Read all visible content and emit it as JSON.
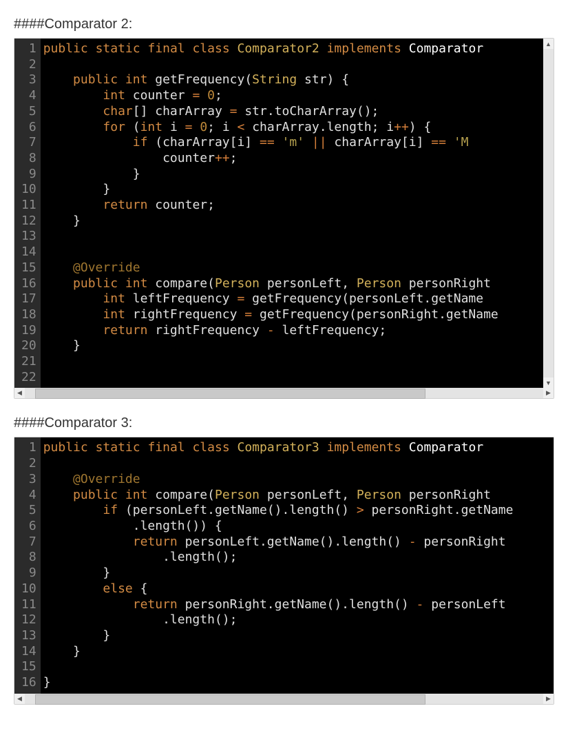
{
  "heading2": "####Comparator 2:",
  "heading3": "####Comparator 3:",
  "block2": {
    "line_count": 22,
    "lines": [
      [
        [
          "kw",
          "public"
        ],
        [
          "plain",
          " "
        ],
        [
          "kw",
          "static"
        ],
        [
          "plain",
          " "
        ],
        [
          "kw",
          "final"
        ],
        [
          "plain",
          " "
        ],
        [
          "kw",
          "class"
        ],
        [
          "plain",
          " "
        ],
        [
          "type",
          "Comparator2"
        ],
        [
          "plain",
          " "
        ],
        [
          "kw",
          "implements"
        ],
        [
          "plain",
          " "
        ],
        [
          "white",
          "Comparator"
        ]
      ],
      [
        [
          "plain",
          ""
        ]
      ],
      [
        [
          "plain",
          "    "
        ],
        [
          "kw",
          "public"
        ],
        [
          "plain",
          " "
        ],
        [
          "kw",
          "int"
        ],
        [
          "plain",
          " getFrequency("
        ],
        [
          "type",
          "String"
        ],
        [
          "plain",
          " str) {"
        ]
      ],
      [
        [
          "plain",
          "        "
        ],
        [
          "kw",
          "int"
        ],
        [
          "plain",
          " counter "
        ],
        [
          "op",
          "="
        ],
        [
          "plain",
          " "
        ],
        [
          "num",
          "0"
        ],
        [
          "plain",
          ";"
        ]
      ],
      [
        [
          "plain",
          "        "
        ],
        [
          "kw",
          "char"
        ],
        [
          "plain",
          "[] charArray "
        ],
        [
          "op",
          "="
        ],
        [
          "plain",
          " str.toCharArray();"
        ]
      ],
      [
        [
          "plain",
          "        "
        ],
        [
          "kw",
          "for"
        ],
        [
          "plain",
          " ("
        ],
        [
          "kw",
          "int"
        ],
        [
          "plain",
          " i "
        ],
        [
          "op",
          "="
        ],
        [
          "plain",
          " "
        ],
        [
          "num",
          "0"
        ],
        [
          "plain",
          "; i "
        ],
        [
          "op",
          "<"
        ],
        [
          "plain",
          " charArray.length; i"
        ],
        [
          "op",
          "++"
        ],
        [
          "plain",
          ") {"
        ]
      ],
      [
        [
          "plain",
          "            "
        ],
        [
          "kw",
          "if"
        ],
        [
          "plain",
          " (charArray[i] "
        ],
        [
          "op",
          "=="
        ],
        [
          "plain",
          " "
        ],
        [
          "str",
          "'m'"
        ],
        [
          "plain",
          " "
        ],
        [
          "op",
          "||"
        ],
        [
          "plain",
          " charArray[i] "
        ],
        [
          "op",
          "=="
        ],
        [
          "plain",
          " "
        ],
        [
          "str",
          "'M"
        ]
      ],
      [
        [
          "plain",
          "                counter"
        ],
        [
          "op",
          "++"
        ],
        [
          "plain",
          ";"
        ]
      ],
      [
        [
          "plain",
          "            }"
        ]
      ],
      [
        [
          "plain",
          "        }"
        ]
      ],
      [
        [
          "plain",
          "        "
        ],
        [
          "kw",
          "return"
        ],
        [
          "plain",
          " counter;"
        ]
      ],
      [
        [
          "plain",
          "    }"
        ]
      ],
      [
        [
          "plain",
          ""
        ]
      ],
      [
        [
          "plain",
          ""
        ]
      ],
      [
        [
          "plain",
          "    "
        ],
        [
          "ann",
          "@Override"
        ]
      ],
      [
        [
          "plain",
          "    "
        ],
        [
          "kw",
          "public"
        ],
        [
          "plain",
          " "
        ],
        [
          "kw",
          "int"
        ],
        [
          "plain",
          " compare("
        ],
        [
          "type",
          "Person"
        ],
        [
          "plain",
          " personLeft, "
        ],
        [
          "type",
          "Person"
        ],
        [
          "plain",
          " personRight"
        ]
      ],
      [
        [
          "plain",
          "        "
        ],
        [
          "kw",
          "int"
        ],
        [
          "plain",
          " leftFrequency "
        ],
        [
          "op",
          "="
        ],
        [
          "plain",
          " getFrequency(personLeft.getName"
        ]
      ],
      [
        [
          "plain",
          "        "
        ],
        [
          "kw",
          "int"
        ],
        [
          "plain",
          " rightFrequency "
        ],
        [
          "op",
          "="
        ],
        [
          "plain",
          " getFrequency(personRight.getName"
        ]
      ],
      [
        [
          "plain",
          "        "
        ],
        [
          "kw",
          "return"
        ],
        [
          "plain",
          " rightFrequency "
        ],
        [
          "op",
          "-"
        ],
        [
          "plain",
          " leftFrequency;"
        ]
      ],
      [
        [
          "plain",
          "    }"
        ]
      ],
      [
        [
          "plain",
          ""
        ]
      ],
      [
        [
          "plain",
          ""
        ]
      ]
    ]
  },
  "block3": {
    "line_count": 16,
    "lines": [
      [
        [
          "kw",
          "public"
        ],
        [
          "plain",
          " "
        ],
        [
          "kw",
          "static"
        ],
        [
          "plain",
          " "
        ],
        [
          "kw",
          "final"
        ],
        [
          "plain",
          " "
        ],
        [
          "kw",
          "class"
        ],
        [
          "plain",
          " "
        ],
        [
          "type",
          "Comparator3"
        ],
        [
          "plain",
          " "
        ],
        [
          "kw",
          "implements"
        ],
        [
          "plain",
          " "
        ],
        [
          "white",
          "Comparator"
        ]
      ],
      [
        [
          "plain",
          ""
        ]
      ],
      [
        [
          "plain",
          "    "
        ],
        [
          "ann",
          "@Override"
        ]
      ],
      [
        [
          "plain",
          "    "
        ],
        [
          "kw",
          "public"
        ],
        [
          "plain",
          " "
        ],
        [
          "kw",
          "int"
        ],
        [
          "plain",
          " compare("
        ],
        [
          "type",
          "Person"
        ],
        [
          "plain",
          " personLeft, "
        ],
        [
          "type",
          "Person"
        ],
        [
          "plain",
          " personRight"
        ]
      ],
      [
        [
          "plain",
          "        "
        ],
        [
          "kw",
          "if"
        ],
        [
          "plain",
          " (personLeft.getName().length() "
        ],
        [
          "op",
          ">"
        ],
        [
          "plain",
          " personRight.getName"
        ]
      ],
      [
        [
          "plain",
          "            .length()) {"
        ]
      ],
      [
        [
          "plain",
          "            "
        ],
        [
          "kw",
          "return"
        ],
        [
          "plain",
          " personLeft.getName().length() "
        ],
        [
          "op",
          "-"
        ],
        [
          "plain",
          " personRight"
        ]
      ],
      [
        [
          "plain",
          "                .length();"
        ]
      ],
      [
        [
          "plain",
          "        }"
        ]
      ],
      [
        [
          "plain",
          "        "
        ],
        [
          "kw",
          "else"
        ],
        [
          "plain",
          " {"
        ]
      ],
      [
        [
          "plain",
          "            "
        ],
        [
          "kw",
          "return"
        ],
        [
          "plain",
          " personRight.getName().length() "
        ],
        [
          "op",
          "-"
        ],
        [
          "plain",
          " personLeft"
        ]
      ],
      [
        [
          "plain",
          "                .length();"
        ]
      ],
      [
        [
          "plain",
          "        }"
        ]
      ],
      [
        [
          "plain",
          "    }"
        ]
      ],
      [
        [
          "plain",
          ""
        ]
      ],
      [
        [
          "plain",
          "}"
        ]
      ]
    ]
  },
  "scroll": {
    "thumb2_left": "2%",
    "thumb2_width": "75%",
    "thumb3_left": "2%",
    "thumb3_width": "75%"
  }
}
